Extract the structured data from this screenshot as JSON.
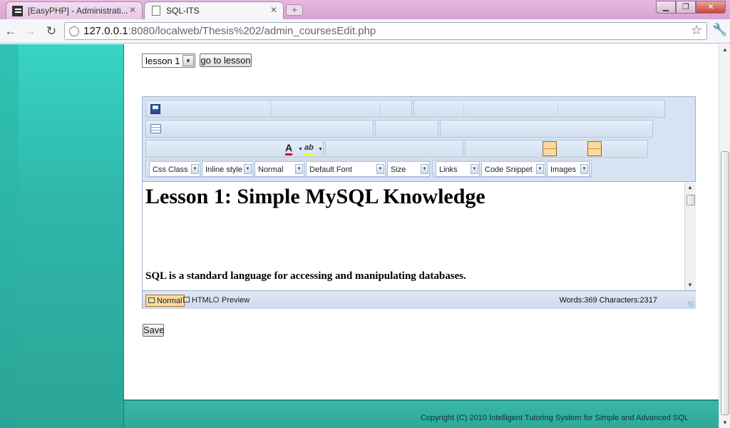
{
  "browser": {
    "tabs": [
      {
        "title": "[EasyPHP] - Administrati...",
        "active": false
      },
      {
        "title": "SQL-ITS",
        "active": true
      }
    ],
    "url": {
      "host": "127.0.0.1",
      "rest": ":8080/localweb/Thesis%202/admin_coursesEdit.php"
    },
    "icons": {
      "back": "back-arrow-icon",
      "forward": "forward-arrow-icon",
      "reload": "reload-icon",
      "bookmark": "star-icon",
      "menu": "wrench-icon"
    }
  },
  "page": {
    "lesson_select": {
      "value": "lesson 1"
    },
    "goto_button": "go to lesson",
    "save_button": "Save",
    "footer": "Copyright (C) 2010 Intelligent Tutoring System for Simple and Advanced SQL"
  },
  "editor": {
    "dropdowns": [
      "Css Class",
      "Inline style",
      "Normal",
      "Default Font",
      "Size",
      "Links",
      "Code Snippet",
      "Images"
    ],
    "content": {
      "heading": "Lesson 1: Simple MySQL Knowledge",
      "paragraph": "SQL is a standard language for accessing and manipulating databases."
    },
    "modes": [
      "Normal",
      "HTML",
      "Preview"
    ],
    "active_mode": "Normal",
    "wordcount": "Words:369 Characters:2317",
    "accent_color": "#fcd9a0"
  }
}
